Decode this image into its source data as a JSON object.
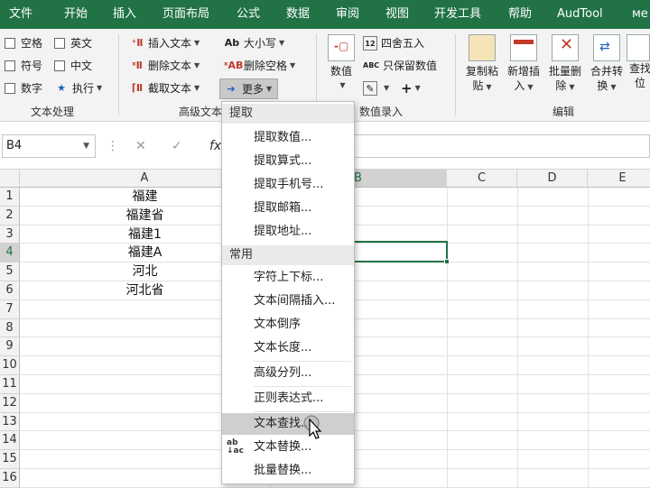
{
  "menu": {
    "tabs": [
      "文件",
      "开始",
      "插入",
      "页面布局",
      "公式",
      "数据",
      "审阅",
      "视图",
      "开发工具",
      "帮助",
      "AudTool",
      "ме"
    ]
  },
  "ribbon": {
    "text_group": {
      "items": [
        "空格",
        "英文",
        "符号",
        "中文",
        "数字",
        "执行"
      ],
      "label": "文本处理"
    },
    "advanced_group": {
      "items": [
        "插入文本",
        "删除文本",
        "截取文本",
        "大小写",
        "删除空格",
        "更多"
      ],
      "label": "高级文本"
    },
    "number_group": {
      "value_btn": [
        "数值"
      ],
      "items": [
        "四舍五入",
        "只保留数值"
      ],
      "label": "数值录入"
    },
    "edit_group": {
      "buttons": [
        [
          "复制粘",
          "贴"
        ],
        [
          "新增插",
          "入"
        ],
        [
          "批量删",
          "除"
        ],
        [
          "合并转",
          "换"
        ],
        [
          "查找",
          "位"
        ]
      ],
      "label": "编辑"
    }
  },
  "formula_bar": {
    "name_box": "B4",
    "fx": "fx"
  },
  "grid": {
    "columns": [
      "A",
      "B",
      "C",
      "D",
      "E"
    ],
    "rows": [
      "1",
      "2",
      "3",
      "4",
      "5",
      "6",
      "7",
      "8",
      "9",
      "10",
      "11",
      "12",
      "13",
      "14",
      "15",
      "16"
    ],
    "col_a_values": [
      "福建",
      "福建省",
      "福建1",
      "福建A",
      "河北",
      "河北省"
    ],
    "selected_row": "4"
  },
  "dropdown": {
    "section1": "提取",
    "section1_items": [
      "提取数值...",
      "提取算式...",
      "提取手机号...",
      "提取邮箱...",
      "提取地址..."
    ],
    "section2": "常用",
    "section2_items": [
      "字符上下标...",
      "文本间隔插入...",
      "文本倒序",
      "文本长度...",
      "高级分列...",
      "正则表达式...",
      "文本查找...",
      "文本替换...",
      "批量替换..."
    ],
    "hover_item": "文本查找..."
  },
  "colors": {
    "accent": "#217346",
    "ribbon_bg": "#f3f3f3",
    "hover": "#cfcfcf"
  }
}
